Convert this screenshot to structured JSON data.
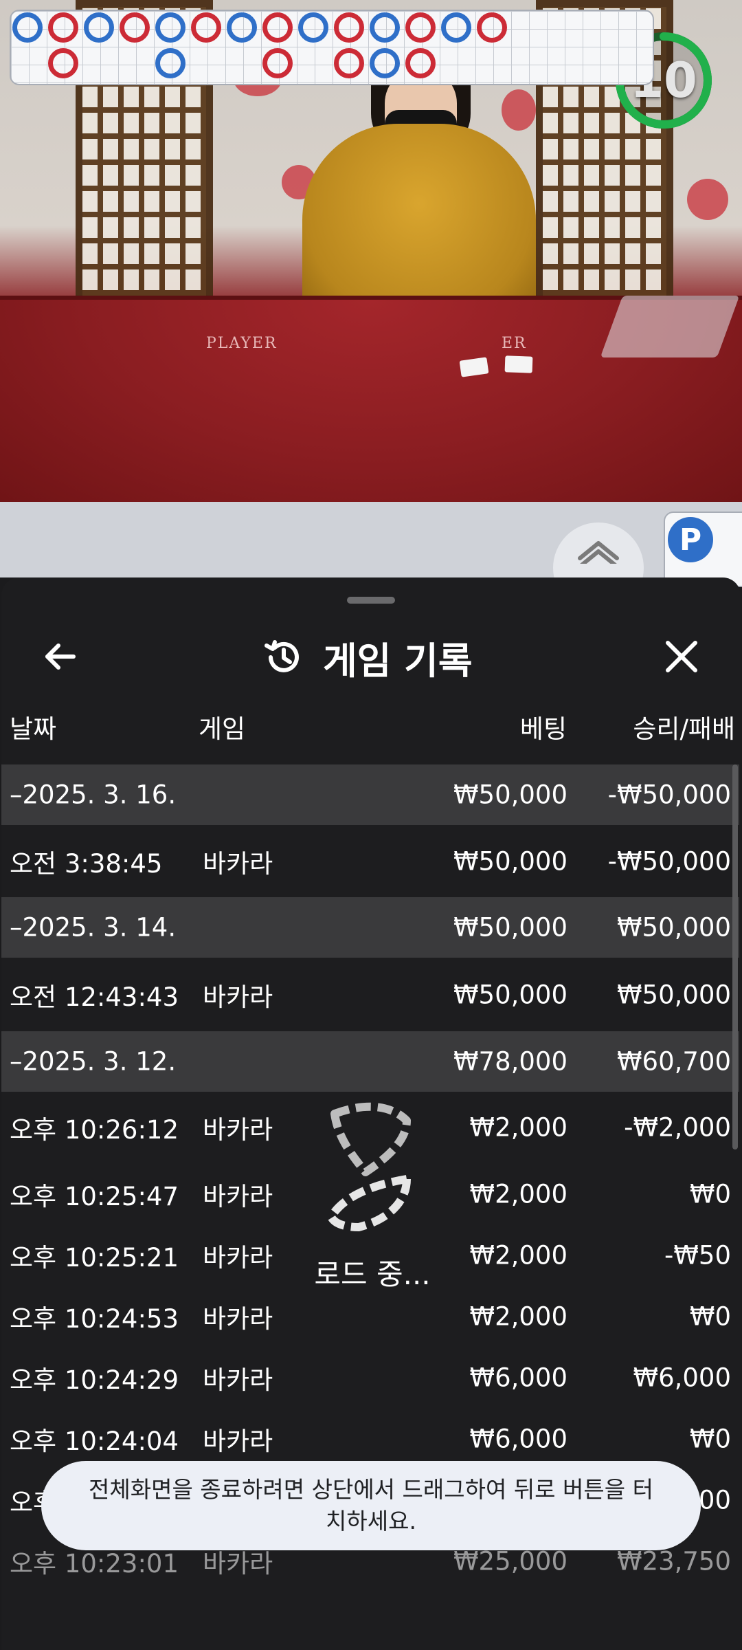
{
  "video": {
    "countdown": "10",
    "table_label_left": "PLAYER",
    "table_label_right": "ER"
  },
  "road": {
    "chip_label": "P"
  },
  "sheet": {
    "title": "게임 기록",
    "columns": {
      "date": "날짜",
      "game": "게임",
      "bet": "베팅",
      "win_loss": "승리/패배"
    },
    "rows": [
      {
        "type": "group",
        "date": "–2025. 3. 16.",
        "game": "",
        "bet": "₩50,000",
        "win_loss": "-₩50,000"
      },
      {
        "type": "item",
        "date": "오전 3:38:45",
        "game": "바카라",
        "bet": "₩50,000",
        "win_loss": "-₩50,000"
      },
      {
        "type": "group",
        "date": "–2025. 3. 14.",
        "game": "",
        "bet": "₩50,000",
        "win_loss": "₩50,000"
      },
      {
        "type": "item",
        "date": "오전 12:43:43",
        "game": "바카라",
        "bet": "₩50,000",
        "win_loss": "₩50,000"
      },
      {
        "type": "group",
        "date": "–2025. 3. 12.",
        "game": "",
        "bet": "₩78,000",
        "win_loss": "₩60,700"
      },
      {
        "type": "item",
        "date": "오후 10:26:12",
        "game": "바카라",
        "bet": "₩2,000",
        "win_loss": "-₩2,000"
      },
      {
        "type": "item",
        "date": "오후 10:25:47",
        "game": "바카라",
        "bet": "₩2,000",
        "win_loss": "₩0"
      },
      {
        "type": "item",
        "date": "오후 10:25:21",
        "game": "바카라",
        "bet": "₩2,000",
        "win_loss": "-₩50"
      },
      {
        "type": "item",
        "date": "오후 10:24:53",
        "game": "바카라",
        "bet": "₩2,000",
        "win_loss": "₩0"
      },
      {
        "type": "item",
        "date": "오후 10:24:29",
        "game": "바카라",
        "bet": "₩6,000",
        "win_loss": "₩6,000"
      },
      {
        "type": "item",
        "date": "오후 10:24:04",
        "game": "바카라",
        "bet": "₩6,000",
        "win_loss": "₩0"
      },
      {
        "type": "item",
        "date": "오후",
        "game": "",
        "bet": "",
        "win_loss": "00"
      },
      {
        "type": "item",
        "date": "오후 10:23:01",
        "game": "바카라",
        "bet": "₩25,000",
        "win_loss": "₩23,750"
      }
    ],
    "loading_text": "로드 중..."
  },
  "toast": {
    "message": "전체화면을 종료하려면 상단에서 드래그하여 뒤로 버튼을 터치하세요."
  },
  "colors": {
    "sheet_bg": "#1d1d1f",
    "group_row_bg": "#3a3a3c",
    "player_blue": "#2f6fc8",
    "banker_red": "#cc2b36",
    "timer_green": "#21b04b",
    "toast_bg": "#eceff6"
  }
}
